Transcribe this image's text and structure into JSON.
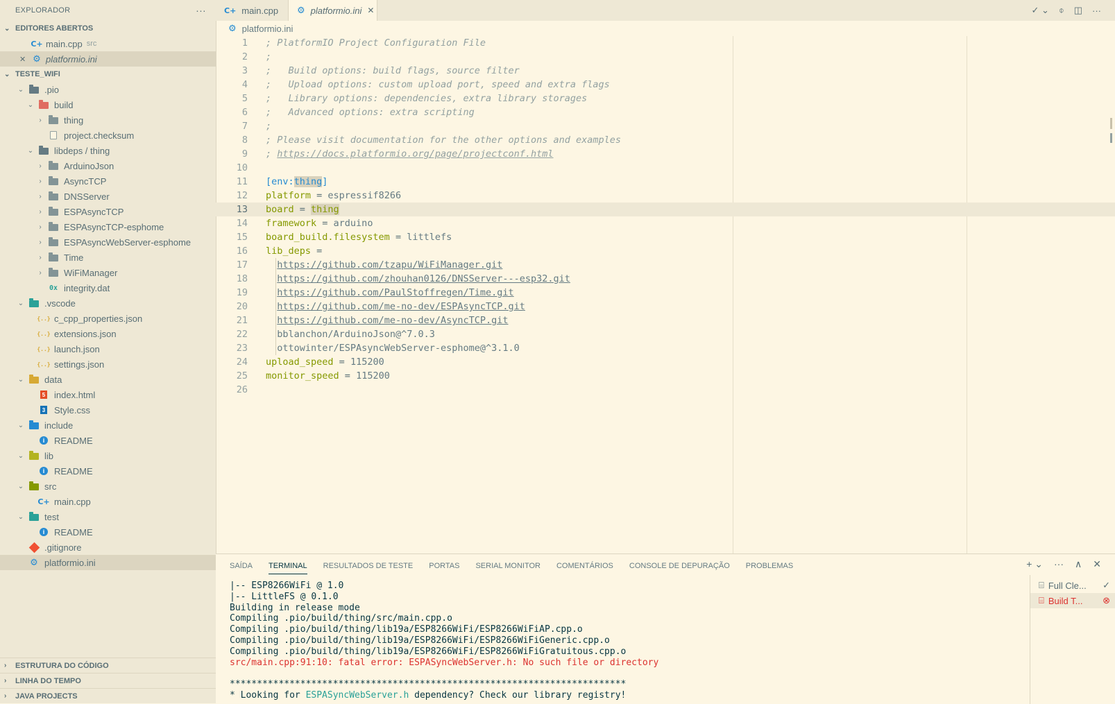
{
  "explorer": {
    "title": "EXPLORADOR",
    "more": "···",
    "open_editors_title": "EDITORES ABERTOS",
    "open_editors": [
      {
        "name": "main.cpp",
        "suffix": "src",
        "icon": "C+"
      },
      {
        "name": "platformio.ini",
        "close": "✕",
        "icon": "⚙"
      }
    ],
    "project_title": "TESTE_WIFI",
    "tree": [
      {
        "label": ".pio",
        "arrow": "⌄",
        "icon": "folder"
      },
      {
        "label": "build",
        "arrow": "⌄",
        "icon": "folder"
      },
      {
        "label": "thing",
        "arrow": "›",
        "icon": "folder"
      },
      {
        "label": "project.checksum",
        "icon": "file"
      },
      {
        "label": "libdeps / thing",
        "arrow": "⌄",
        "icon": "folder"
      },
      {
        "label": "ArduinoJson",
        "arrow": "›",
        "icon": "folder"
      },
      {
        "label": "AsyncTCP",
        "arrow": "›",
        "icon": "folder"
      },
      {
        "label": "DNSServer",
        "arrow": "›",
        "icon": "folder"
      },
      {
        "label": "ESPAsyncTCP",
        "arrow": "›",
        "icon": "folder"
      },
      {
        "label": "ESPAsyncTCP-esphome",
        "arrow": "›",
        "icon": "folder"
      },
      {
        "label": "ESPAsyncWebServer-esphome",
        "arrow": "›",
        "icon": "folder"
      },
      {
        "label": "Time",
        "arrow": "›",
        "icon": "folder"
      },
      {
        "label": "WiFiManager",
        "arrow": "›",
        "icon": "folder"
      },
      {
        "label": "integrity.dat",
        "icon": "0x"
      },
      {
        "label": ".vscode",
        "arrow": "⌄",
        "icon": "folder"
      },
      {
        "label": "c_cpp_properties.json",
        "icon": "{..}"
      },
      {
        "label": "extensions.json",
        "icon": "{..}"
      },
      {
        "label": "launch.json",
        "icon": "{..}"
      },
      {
        "label": "settings.json",
        "icon": "{..}"
      },
      {
        "label": "data",
        "arrow": "⌄",
        "icon": "folder"
      },
      {
        "label": "index.html",
        "icon": "5"
      },
      {
        "label": "Style.css",
        "icon": "3"
      },
      {
        "label": "include",
        "arrow": "⌄",
        "icon": "folder"
      },
      {
        "label": "README",
        "icon": "i"
      },
      {
        "label": "lib",
        "arrow": "⌄",
        "icon": "folder"
      },
      {
        "label": "README",
        "icon": "i"
      },
      {
        "label": "src",
        "arrow": "⌄",
        "icon": "folder"
      },
      {
        "label": "main.cpp",
        "icon": "C+"
      },
      {
        "label": "test",
        "arrow": "⌄",
        "icon": "folder"
      },
      {
        "label": "README",
        "icon": "i"
      },
      {
        "label": ".gitignore",
        "icon": "git"
      },
      {
        "label": "platformio.ini",
        "icon": "⚙"
      }
    ],
    "bottom_sections": [
      "ESTRUTURA DO CÓDIGO",
      "LINHA DO TEMPO",
      "JAVA PROJECTS"
    ]
  },
  "tabs": [
    {
      "label": "main.cpp",
      "icon": "C+"
    },
    {
      "label": "platformio.ini",
      "icon": "⚙",
      "close": "✕"
    }
  ],
  "tab_actions": [
    "✓ ⌄",
    "⌽",
    "◫",
    "···"
  ],
  "breadcrumb": "platformio.ini",
  "editor": {
    "lines": [
      {
        "n": "1",
        "text": "; PlatformIO Project Configuration File"
      },
      {
        "n": "2",
        "text": ";"
      },
      {
        "n": "3",
        "text": ";   Build options: build flags, source filter"
      },
      {
        "n": "4",
        "text": ";   Upload options: custom upload port, speed and extra flags"
      },
      {
        "n": "5",
        "text": ";   Library options: dependencies, extra library storages"
      },
      {
        "n": "6",
        "text": ";   Advanced options: extra scripting"
      },
      {
        "n": "7",
        "text": ";"
      },
      {
        "n": "8",
        "text": "; Please visit documentation for the other options and examples"
      },
      {
        "n": "9",
        "pre": "; ",
        "url": "https://docs.platformio.org/page/projectconf.html"
      },
      {
        "n": "10",
        "text": ""
      },
      {
        "n": "11",
        "open": "[env:",
        "hl": "thing",
        "close": "]"
      },
      {
        "n": "12",
        "key": "platform",
        "val": "espressif8266"
      },
      {
        "n": "13",
        "key": "board",
        "hl": "thing"
      },
      {
        "n": "14",
        "key": "framework",
        "val": "arduino"
      },
      {
        "n": "15",
        "key": "board_build.filesystem",
        "val": "littlefs"
      },
      {
        "n": "16",
        "key": "lib_deps",
        "val": ""
      },
      {
        "n": "17",
        "url": "https://github.com/tzapu/WiFiManager.git"
      },
      {
        "n": "18",
        "url": "https://github.com/zhouhan0126/DNSServer---esp32.git"
      },
      {
        "n": "19",
        "url": "https://github.com/PaulStoffregen/Time.git"
      },
      {
        "n": "20",
        "url": "https://github.com/me-no-dev/ESPAsyncTCP.git"
      },
      {
        "n": "21",
        "url": "https://github.com/me-no-dev/AsyncTCP.git"
      },
      {
        "n": "22",
        "plain": "bblanchon/ArduinoJson@^7.0.3"
      },
      {
        "n": "23",
        "plain": "ottowinter/ESPAsyncWebServer-esphome@^3.1.0"
      },
      {
        "n": "24",
        "key": "upload_speed",
        "val": "115200"
      },
      {
        "n": "25",
        "key": "monitor_speed",
        "val": "115200"
      },
      {
        "n": "26",
        "text": ""
      }
    ]
  },
  "panel": {
    "tabs": [
      "SAÍDA",
      "TERMINAL",
      "RESULTADOS DE TESTE",
      "PORTAS",
      "SERIAL MONITOR",
      "COMENTÁRIOS",
      "CONSOLE DE DEPURAÇÃO",
      "PROBLEMAS"
    ],
    "actions": [
      "+ ⌄",
      "···",
      "∧",
      "✕"
    ],
    "terminal_lines": [
      "|-- ESP8266WiFi @ 1.0",
      "|-- LittleFS @ 0.1.0",
      "Building in release mode",
      "Compiling .pio/build/thing/src/main.cpp.o",
      "Compiling .pio/build/thing/lib19a/ESP8266WiFi/ESP8266WiFiAP.cpp.o",
      "Compiling .pio/build/thing/lib19a/ESP8266WiFi/ESP8266WiFiGeneric.cpp.o",
      "Compiling .pio/build/thing/lib19a/ESP8266WiFi/ESP8266WiFiGratuitous.cpp.o"
    ],
    "error_line": "src/main.cpp:91:10: fatal error: ESPASyncWebServer.h: No such file or directory",
    "stars": "*************************************************************************",
    "looking_pre": "* Looking for ",
    "looking_link": "ESPASyncWebServer.h",
    "looking_post": " dependency? Check our library registry!",
    "terminals": [
      {
        "label": "Full Cle...",
        "status": "✓"
      },
      {
        "label": "Build T...",
        "status": "⊗"
      }
    ]
  },
  "colors": {
    "background": "#fdf6e3",
    "sidebar": "#eee8d5",
    "accent": "#268bd2",
    "error": "#dc322f"
  }
}
